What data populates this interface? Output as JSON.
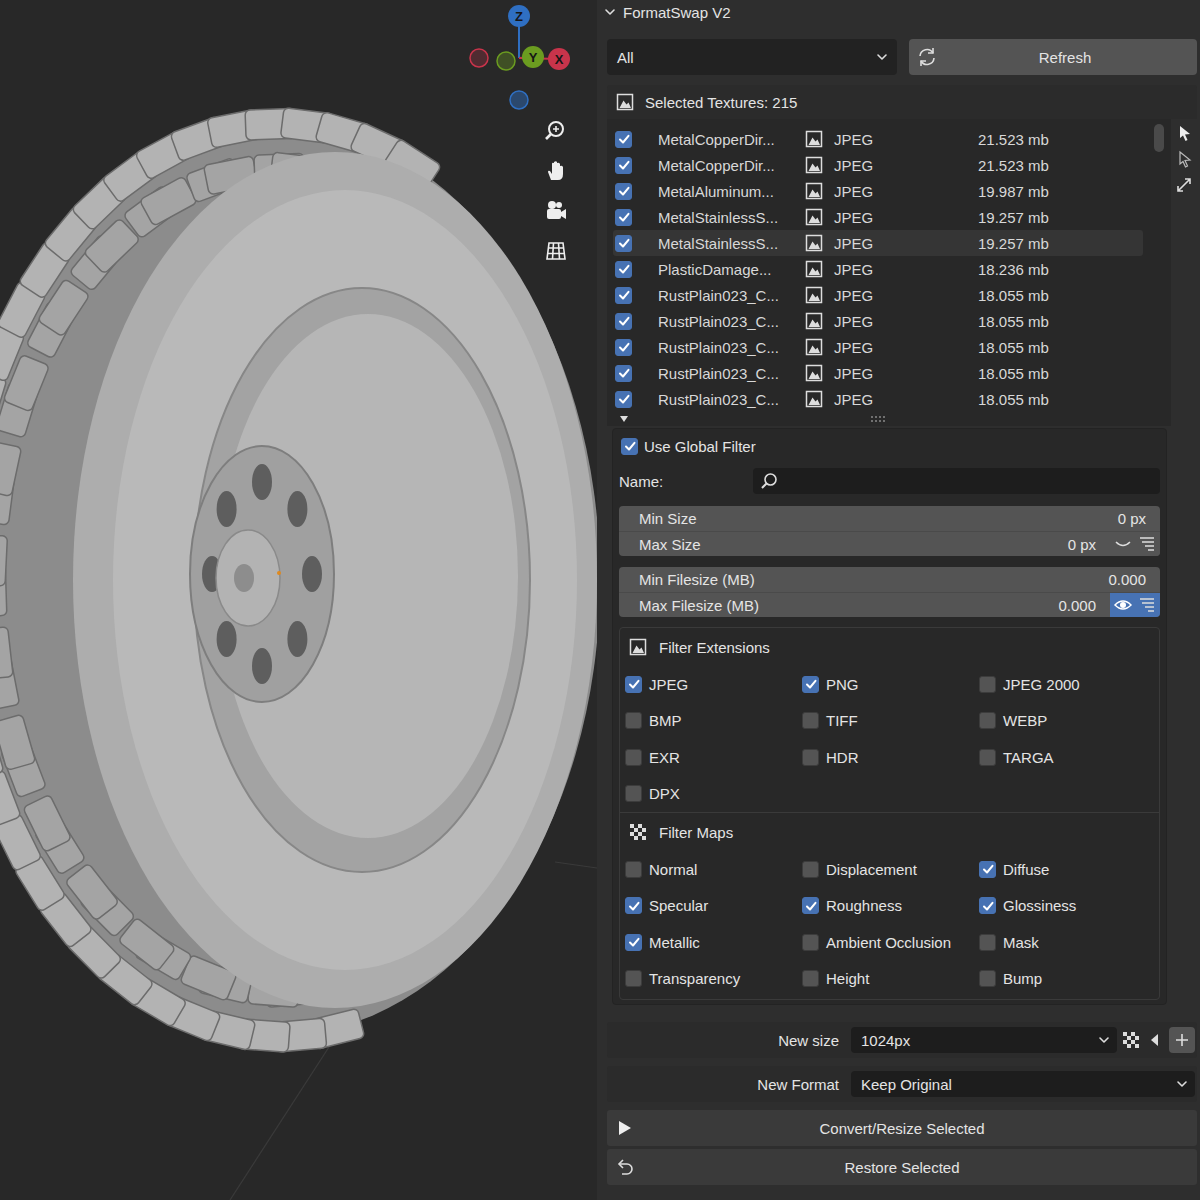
{
  "viewport": {
    "gizmo_axes": [
      {
        "label": "Z",
        "color": "#2f6fc2"
      },
      {
        "label": "Y",
        "color": "#6b9c20"
      },
      {
        "label": "X",
        "color": "#c9344b"
      }
    ]
  },
  "panel": {
    "title": "FormatSwap V2",
    "expanded": true
  },
  "toolbar": {
    "filter_dropdown": "All",
    "refresh_button": "Refresh"
  },
  "texture_list": {
    "header": "Selected Textures: 215",
    "rows": [
      {
        "name": "MetalCopperDir...",
        "format": "JPEG",
        "size": "21.523 mb",
        "checked": true,
        "selected": false
      },
      {
        "name": "MetalCopperDir...",
        "format": "JPEG",
        "size": "21.523 mb",
        "checked": true,
        "selected": false
      },
      {
        "name": "MetalAluminum...",
        "format": "JPEG",
        "size": "19.987 mb",
        "checked": true,
        "selected": false
      },
      {
        "name": "MetalStainlessS...",
        "format": "JPEG",
        "size": "19.257 mb",
        "checked": true,
        "selected": false
      },
      {
        "name": "MetalStainlessS...",
        "format": "JPEG",
        "size": "19.257 mb",
        "checked": true,
        "selected": true
      },
      {
        "name": "PlasticDamage...",
        "format": "JPEG",
        "size": "18.236 mb",
        "checked": true,
        "selected": false
      },
      {
        "name": "RustPlain023_C...",
        "format": "JPEG",
        "size": "18.055 mb",
        "checked": true,
        "selected": false
      },
      {
        "name": "RustPlain023_C...",
        "format": "JPEG",
        "size": "18.055 mb",
        "checked": true,
        "selected": false
      },
      {
        "name": "RustPlain023_C...",
        "format": "JPEG",
        "size": "18.055 mb",
        "checked": true,
        "selected": false
      },
      {
        "name": "RustPlain023_C...",
        "format": "JPEG",
        "size": "18.055 mb",
        "checked": true,
        "selected": false
      },
      {
        "name": "RustPlain023_C...",
        "format": "JPEG",
        "size": "18.055 mb",
        "checked": true,
        "selected": false
      }
    ]
  },
  "global_filter": {
    "label": "Use Global Filter",
    "checked": true
  },
  "name_filter": {
    "label": "Name:"
  },
  "size_range": {
    "fields": [
      {
        "label": "Min Size",
        "value": "0 px"
      },
      {
        "label": "Max Size",
        "value": "0 px"
      }
    ],
    "enabled": false
  },
  "filesize_range": {
    "fields": [
      {
        "label": "Min Filesize (MB)",
        "value": "0.000"
      },
      {
        "label": "Max Filesize (MB)",
        "value": "0.000"
      }
    ],
    "enabled": true
  },
  "extensions": {
    "title": "Filter Extensions",
    "items": [
      {
        "label": "JPEG",
        "checked": true
      },
      {
        "label": "PNG",
        "checked": true
      },
      {
        "label": "JPEG 2000",
        "checked": false
      },
      {
        "label": "BMP",
        "checked": false
      },
      {
        "label": "TIFF",
        "checked": false
      },
      {
        "label": "WEBP",
        "checked": false
      },
      {
        "label": "EXR",
        "checked": false
      },
      {
        "label": "HDR",
        "checked": false
      },
      {
        "label": "TARGA",
        "checked": false
      },
      {
        "label": "DPX",
        "checked": false
      }
    ]
  },
  "maps": {
    "title": "Filter Maps",
    "items": [
      {
        "label": "Normal",
        "checked": false
      },
      {
        "label": "Displacement",
        "checked": false
      },
      {
        "label": "Diffuse",
        "checked": true
      },
      {
        "label": "Specular",
        "checked": true
      },
      {
        "label": "Roughness",
        "checked": true
      },
      {
        "label": "Glossiness",
        "checked": true
      },
      {
        "label": "Metallic",
        "checked": true
      },
      {
        "label": "Ambient Occlusion",
        "checked": false
      },
      {
        "label": "Mask",
        "checked": false
      },
      {
        "label": "Transparency",
        "checked": false
      },
      {
        "label": "Height",
        "checked": false
      },
      {
        "label": "Bump",
        "checked": false
      }
    ]
  },
  "new_size": {
    "label": "New size",
    "value": "1024px"
  },
  "new_format": {
    "label": "New Format",
    "value": "Keep Original"
  },
  "actions": [
    {
      "label": "Convert/Resize Selected"
    },
    {
      "label": "Restore Selected"
    }
  ]
}
